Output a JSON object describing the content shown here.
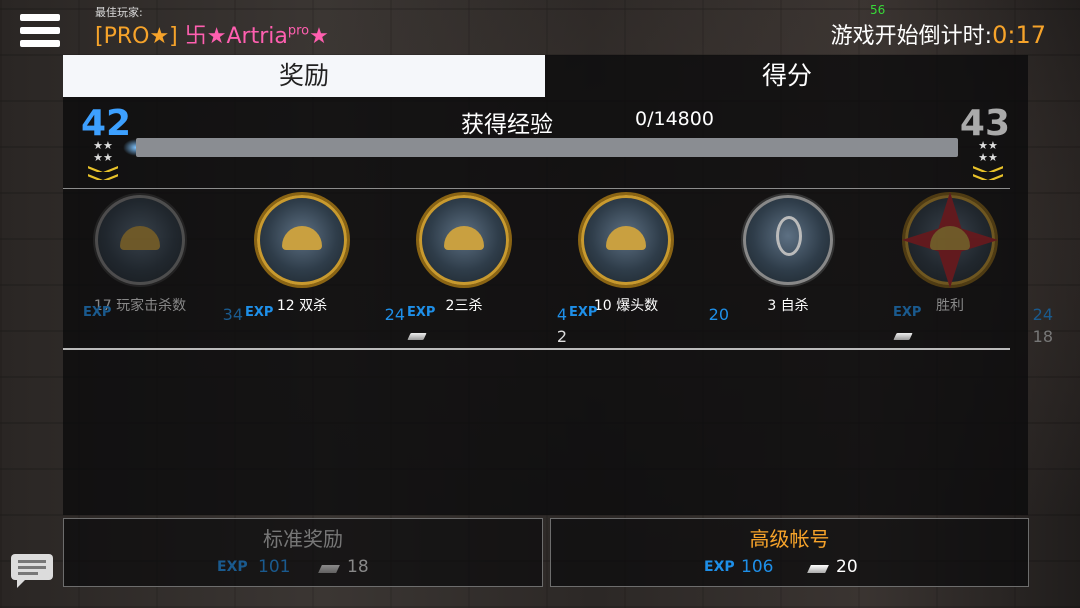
{
  "header": {
    "best_player_label": "最佳玩家:",
    "best_player_name_prefix": "[PRO★]",
    "best_player_name": "卐★Artria",
    "best_player_name_sup": "pro",
    "best_player_name_suffix": "★",
    "fps": "56",
    "countdown_label": "游戏开始倒计时:",
    "countdown_time": "0:17"
  },
  "tabs": {
    "rewards": "奖励",
    "score": "得分",
    "active": "rewards"
  },
  "progress": {
    "current_level": "42",
    "next_level": "43",
    "title": "获得经验",
    "value_text": "0/14800",
    "fill_fraction": 0
  },
  "awards": [
    {
      "name": "17 玩家击杀数",
      "exp_label": "EXP",
      "exp": "34",
      "silver": "",
      "icon": "helmet-medal-icon",
      "dim": true
    },
    {
      "name": "12 双杀",
      "exp_label": "EXP",
      "exp": "24",
      "silver": "",
      "icon": "double-helmet-medal-icon",
      "dim": false
    },
    {
      "name": "2三杀",
      "exp_label": "EXP",
      "exp": "4",
      "silver": "2",
      "icon": "triple-helmet-medal-icon",
      "dim": false
    },
    {
      "name": "10 爆头数",
      "exp_label": "EXP",
      "exp": "20",
      "silver": "",
      "icon": "headshot-cross-medal-icon",
      "dim": false
    },
    {
      "name": "3 自杀",
      "exp_label": "",
      "exp": "",
      "silver": "",
      "icon": "noose-medal-icon",
      "dim": false
    },
    {
      "name": "胜利",
      "exp_label": "EXP",
      "exp": "24",
      "silver": "18",
      "icon": "victory-eagle-medal-icon",
      "dim": true
    }
  ],
  "standard": {
    "title": "标准奖励",
    "exp_label": "EXP",
    "exp": "101",
    "silver": "18"
  },
  "premium": {
    "title": "高级帐号",
    "exp_label": "EXP",
    "exp": "106",
    "silver": "20"
  },
  "colors": {
    "accent_blue": "#3da0ff",
    "gold": "#f6a32a",
    "exp_blue": "#1e8fe8"
  }
}
